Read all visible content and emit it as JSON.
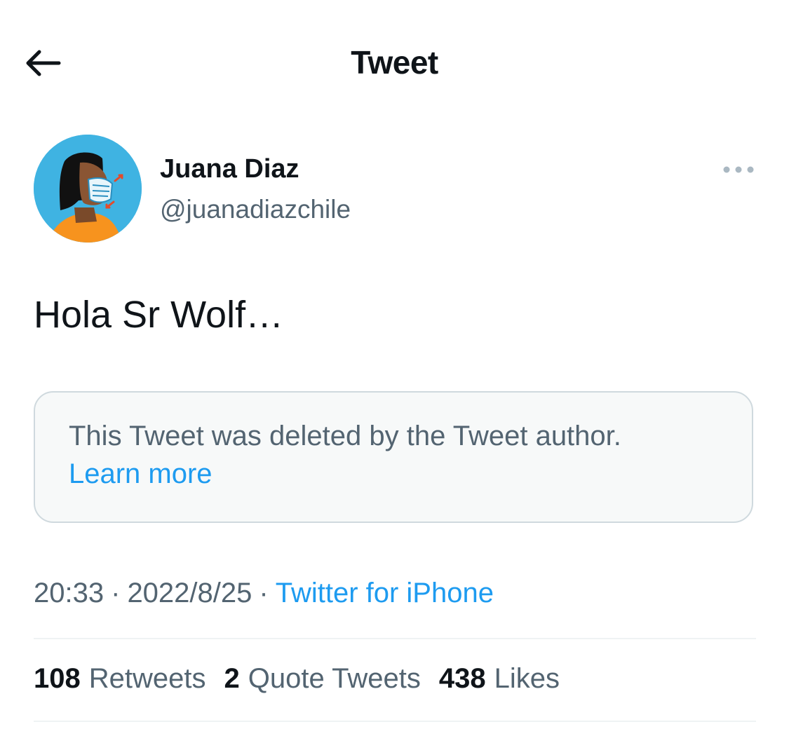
{
  "header": {
    "title": "Tweet",
    "back_icon": "arrow-left-icon"
  },
  "author": {
    "display_name": "Juana Diaz",
    "handle": "@juanadiazchile",
    "avatar_icon": "masked-person-avatar",
    "more_icon": "more-dots-icon"
  },
  "tweet": {
    "text": "Hola Sr Wolf…"
  },
  "quoted": {
    "message": "This Tweet was deleted by the Tweet author.",
    "link_label": "Learn more"
  },
  "meta": {
    "time": "20:33",
    "date": "2022/8/25",
    "separator": "·",
    "source": "Twitter for iPhone"
  },
  "stats": [
    {
      "count": "108",
      "label": "Retweets"
    },
    {
      "count": "2",
      "label": "Quote Tweets"
    },
    {
      "count": "438",
      "label": "Likes"
    }
  ],
  "colors": {
    "accent": "#1d9bf0",
    "secondary_text": "#536471",
    "primary_text": "#0f1419",
    "avatar_bg": "#3fb3e2"
  }
}
